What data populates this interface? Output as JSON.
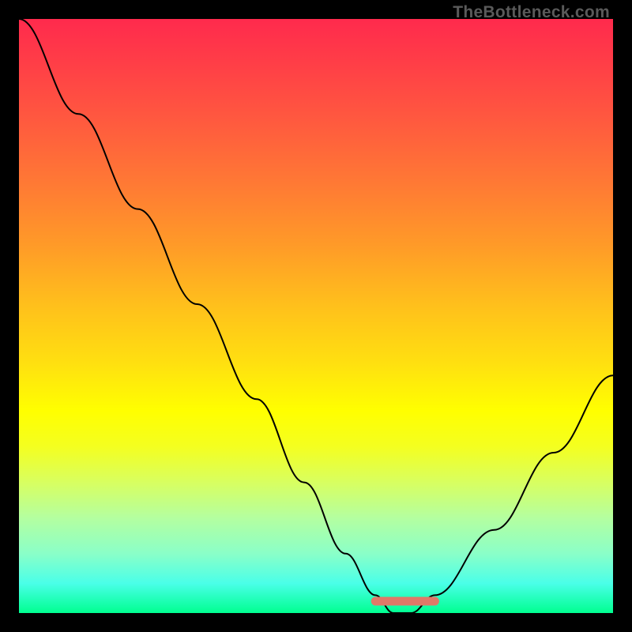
{
  "attribution": "TheBottleneck.com",
  "chart_data": {
    "type": "line",
    "title": "",
    "xlabel": "",
    "ylabel": "",
    "xlim": [
      0,
      100
    ],
    "ylim": [
      0,
      100
    ],
    "series": [
      {
        "name": "bottleneck-curve",
        "x": [
          0,
          10,
          20,
          30,
          40,
          48,
          55,
          60,
          63,
          66,
          70,
          80,
          90,
          100
        ],
        "values": [
          100,
          84,
          68,
          52,
          36,
          22,
          10,
          3,
          0,
          0,
          3,
          14,
          27,
          40
        ]
      },
      {
        "name": "optimal-range-marker",
        "x": [
          60,
          70
        ],
        "values": [
          2,
          2
        ]
      }
    ],
    "colors": {
      "curve": "#000000",
      "marker": "#e07868",
      "gradient_top": "#ff2a4d",
      "gradient_bottom": "#00ff90"
    }
  }
}
